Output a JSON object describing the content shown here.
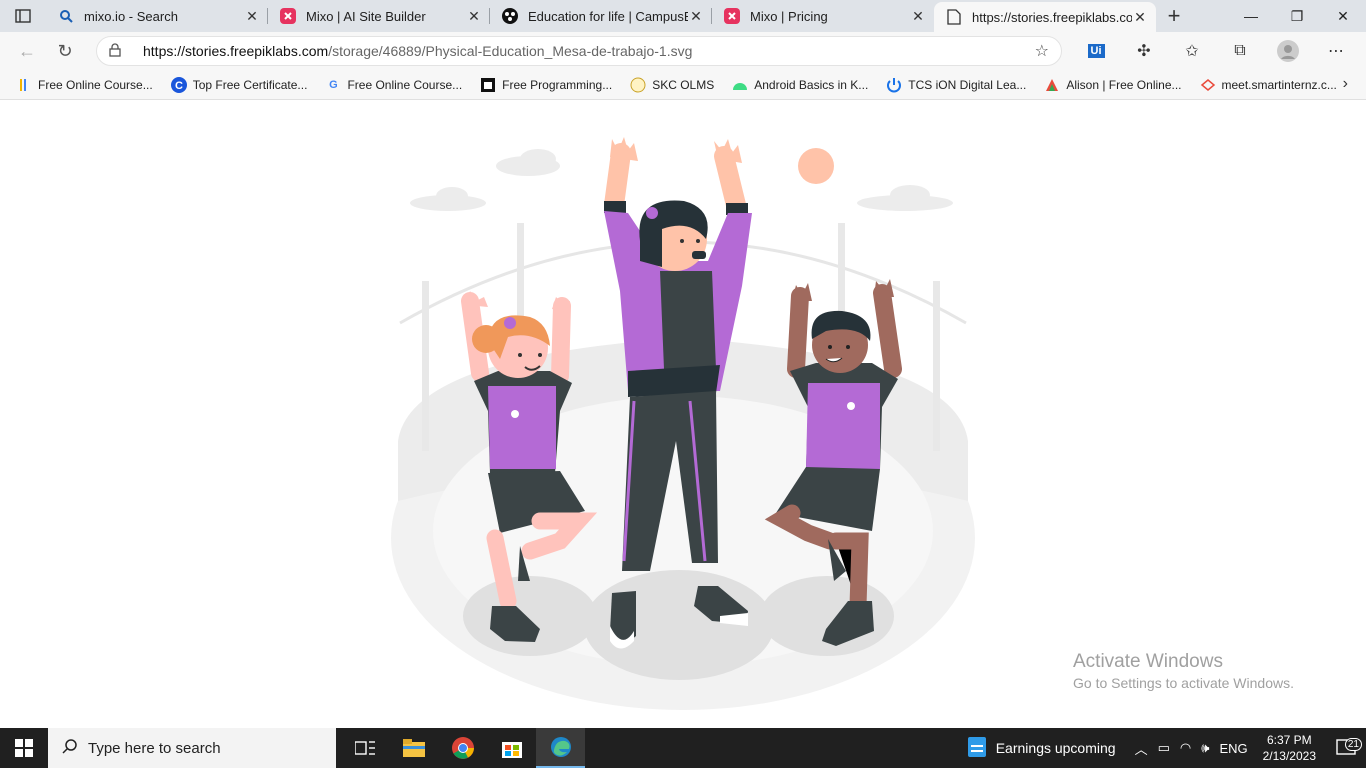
{
  "tabs": [
    {
      "title": "mixo.io - Search",
      "icon": "search-icon"
    },
    {
      "title": "Mixo | AI Site Builder",
      "icon": "mixo-icon"
    },
    {
      "title": "Education for life | CampusBl",
      "icon": "campus-icon"
    },
    {
      "title": "Mixo | Pricing",
      "icon": "mixo-icon"
    },
    {
      "title": "https://stories.freepiklabs.com",
      "icon": "page-icon",
      "active": true
    }
  ],
  "address": {
    "host": "https://stories.freepiklabs.com",
    "path": "/storage/46889/Physical-Education_Mesa-de-trabajo-1.svg"
  },
  "bookmarks": [
    {
      "label": "Free Online Course...",
      "icon": "bar-icon"
    },
    {
      "label": "Top Free Certificate...",
      "icon": "c-icon"
    },
    {
      "label": "Free Online Course...",
      "icon": "g-icon"
    },
    {
      "label": "Free Programming...",
      "icon": "square-icon"
    },
    {
      "label": "SKC OLMS",
      "icon": "olms-icon"
    },
    {
      "label": "Android Basics in K...",
      "icon": "android-icon"
    },
    {
      "label": "TCS iON Digital Lea...",
      "icon": "power-icon"
    },
    {
      "label": "Alison | Free Online...",
      "icon": "alison-icon"
    },
    {
      "label": "meet.smartinternz.c...",
      "icon": "meet-icon"
    }
  ],
  "watermark": {
    "title": "Activate Windows",
    "subtitle": "Go to Settings to activate Windows."
  },
  "taskbar": {
    "search_placeholder": "Type here to search",
    "news": "Earnings upcoming",
    "lang": "ENG",
    "time": "6:37 PM",
    "date": "2/13/2023",
    "notifications": "21"
  }
}
